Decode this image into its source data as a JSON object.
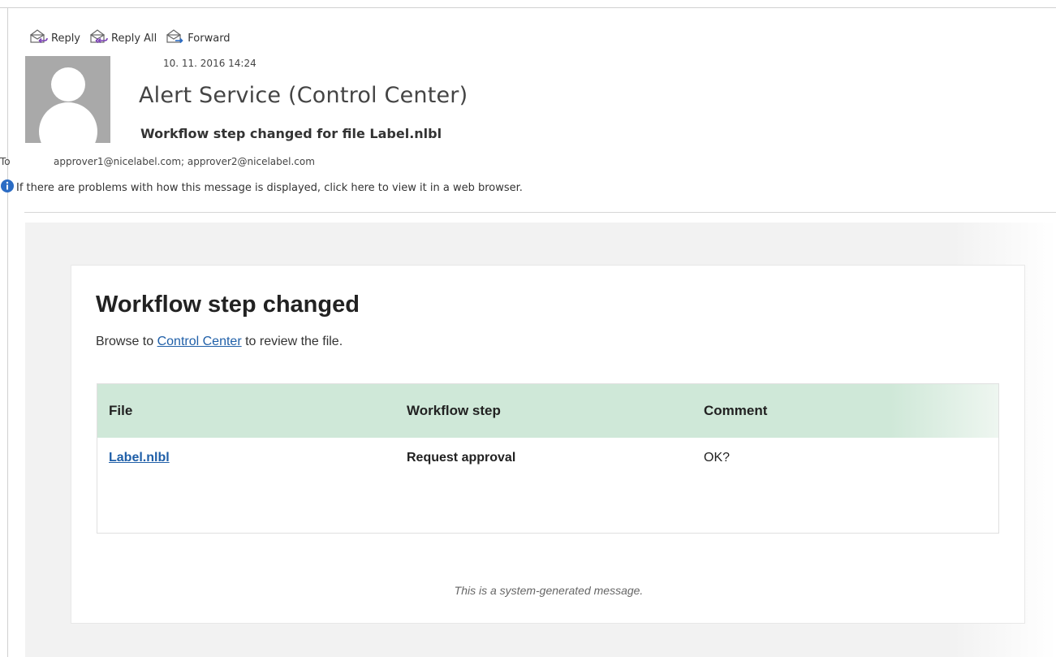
{
  "toolbar": {
    "reply_label": "Reply",
    "reply_all_label": "Reply All",
    "forward_label": "Forward"
  },
  "message": {
    "date": "10. 11. 2016 14:24",
    "sender": "Alert Service (Control Center)",
    "subject": "Workflow step changed for file Label.nlbl",
    "to_label": "To",
    "to_recipients": "approver1@nicelabel.com; approver2@nicelabel.com",
    "info_text": "If there are problems with how this message is displayed, click here to view it in a web browser."
  },
  "body": {
    "heading": "Workflow step changed",
    "intro_prefix": "Browse to",
    "intro_link": "Control Center",
    "intro_suffix": "to review the file.",
    "table": {
      "columns": [
        "File",
        "Workflow step",
        "Comment"
      ],
      "rows": [
        [
          "Label.nlbl",
          "Request approval",
          "OK?"
        ]
      ]
    },
    "footer": "This is a system-generated message."
  },
  "colors": {
    "link": "#1f5fa8",
    "table_header_bg": "#cfe8d8",
    "body_bg": "#f2f2f2",
    "info_icon": "#2b6cc4",
    "reply_arrow": "#7a3fb5",
    "forward_arrow": "#2b6cc4"
  },
  "icons": {
    "reply": "reply-envelope-icon",
    "reply_all": "reply-all-envelope-icon",
    "forward": "forward-envelope-icon",
    "info": "info-icon",
    "avatar": "person-silhouette-icon"
  }
}
